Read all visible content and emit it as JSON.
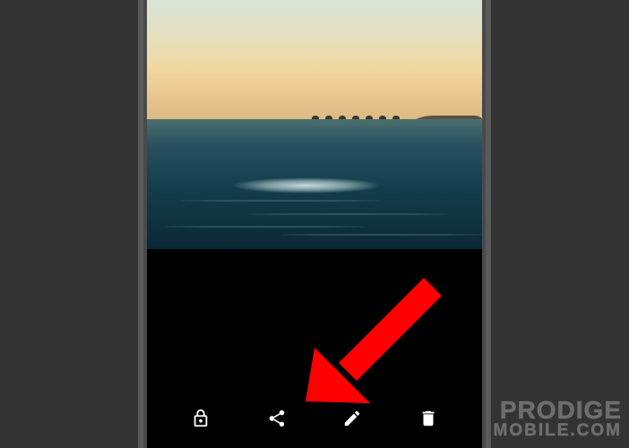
{
  "toolbar": {
    "lock_icon": "lock-icon",
    "share_icon": "share-icon",
    "edit_icon": "edit-icon",
    "delete_icon": "delete-icon"
  },
  "watermark": {
    "line1": "PRODIGE",
    "line2": "MOBILE.COM"
  },
  "annotation": {
    "type": "red-arrow",
    "points_to": "edit-button"
  }
}
